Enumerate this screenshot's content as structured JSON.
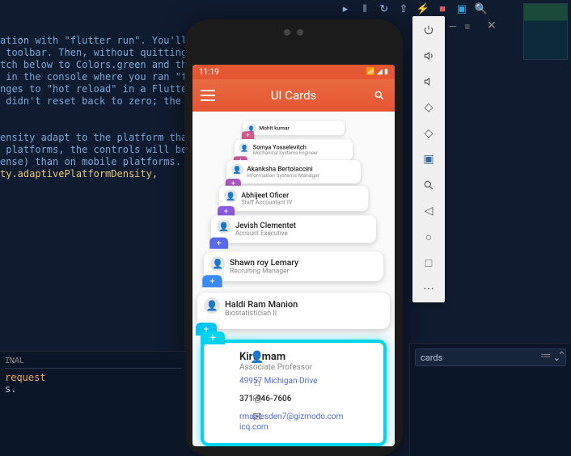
{
  "editor": {
    "lines": [
      "ation with \"flutter run\". You'll se",
      " toolbar. Then, without quitting the",
      "tch below to Colors.green and then",
      " in the console where you ran \"flut",
      "nges to \"hot reload\" in a Flutter I",
      " didn't reset back to zero; the app"
    ],
    "lines2": [
      "ensity adapt to the platform that y",
      " platforms, the controls will be sm",
      "ense) than on mobile platforms.",
      "ty.adaptivePlatformDensity,"
    ]
  },
  "phone": {
    "status_time": "11:19",
    "app_title": "UI Cards",
    "cards": [
      {
        "name": "Mohit kumar",
        "role": "",
        "color": "#d85a8c"
      },
      {
        "name": "Somya Yosselevitch",
        "role": "Mechanical Systems Engineer",
        "color": "#c75a9c"
      },
      {
        "name": "Akanksha Bertolaccini",
        "role": "Information Systems Manager",
        "color": "#a85abf"
      },
      {
        "name": "Abhijeet Oficer",
        "role": "Staff Accountant IV",
        "color": "#8a5ae0"
      },
      {
        "name": "Jevish Clementet",
        "role": "Account Executive",
        "color": "#5a6af0"
      },
      {
        "name": "Shawn roy Lemary",
        "role": "Recruiting Manager",
        "color": "#3a8af5"
      },
      {
        "name": "Haldi Ram Manion",
        "role": "Biostatistician II",
        "color": "#00c4f5"
      }
    ],
    "expanded": {
      "name": "Kirti mam",
      "role": "Associate Professor",
      "address": "49957 Michigan Drive",
      "phone": "371-946-7606",
      "email": "rmaplesden7@gizmodo.com",
      "site": "icq.com"
    }
  },
  "emulator_buttons": [
    "power-icon",
    "volume-up-icon",
    "volume-down-icon",
    "rotate-left-icon",
    "rotate-right-icon",
    "camera-icon",
    "zoom-icon",
    "back-icon",
    "home-icon",
    "overview-icon",
    "more-icon"
  ],
  "terminal": {
    "tab": "INAL",
    "line1": "request",
    "line2": "s."
  },
  "right_panel": {
    "dropdown": "cards"
  }
}
